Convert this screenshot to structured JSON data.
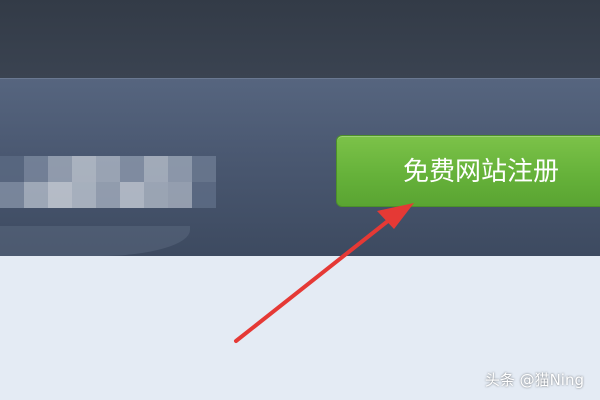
{
  "header": {
    "register_button_label": "免费网站注册"
  },
  "annotation": {
    "arrow_color": "#e53935",
    "arrow_points_to": "register-button"
  },
  "watermark": {
    "text": "头条 @猫Ning"
  },
  "colors": {
    "top_bar": "#343c48",
    "banner": "#4f5d76",
    "button_green": "#6bb63d",
    "page_background": "#e4ebf4"
  }
}
